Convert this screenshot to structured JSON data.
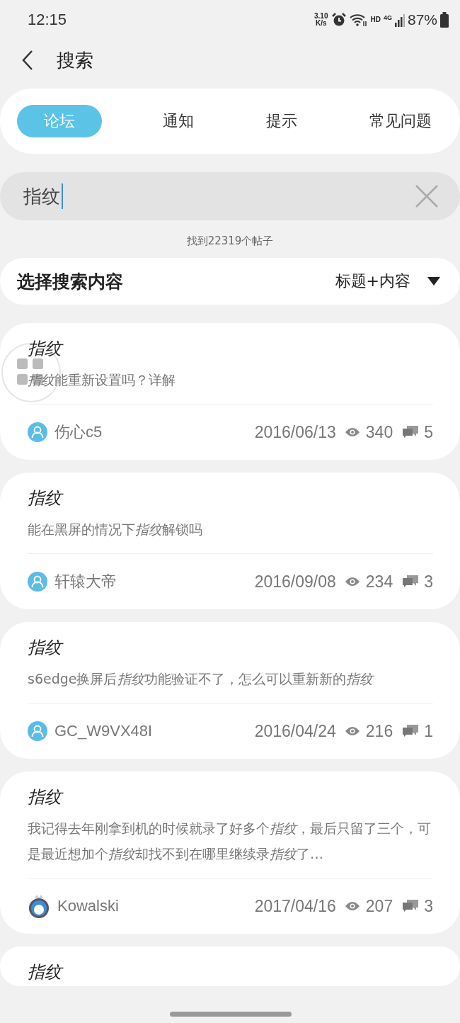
{
  "status_bar": {
    "time": "12:15",
    "speed": "3.10",
    "speed_unit": "K/s",
    "network": "HD",
    "generation": "4G",
    "battery": "87%"
  },
  "header": {
    "title": "搜索"
  },
  "tabs": [
    {
      "label": "论坛",
      "selected": true
    },
    {
      "label": "通知",
      "selected": false
    },
    {
      "label": "提示",
      "selected": false
    },
    {
      "label": "常见问题",
      "selected": false
    }
  ],
  "search": {
    "value": "指纹"
  },
  "result_count": "找到22319个帖子",
  "filter": {
    "label": "选择搜索内容",
    "value": "标题+内容"
  },
  "posts": [
    {
      "kind": "plain_avatar",
      "title": "指纹",
      "body": [
        {
          "text": "指纹",
          "italic": true
        },
        {
          "text": "能重新设置吗？详解",
          "italic": false
        }
      ],
      "author": "伤心c5",
      "date": "2016/06/13",
      "views": "340",
      "replies": "5"
    },
    {
      "kind": "plain_avatar",
      "title": "指纹",
      "body": [
        {
          "text": "能在黑屏的情况下",
          "italic": false
        },
        {
          "text": "指纹",
          "italic": true
        },
        {
          "text": "解锁吗",
          "italic": false
        }
      ],
      "author": "轩辕大帝",
      "date": "2016/09/08",
      "views": "234",
      "replies": "3"
    },
    {
      "kind": "plain_avatar",
      "title": "指纹",
      "body": [
        {
          "text": "s6edge换屏后",
          "italic": false
        },
        {
          "text": "指纹",
          "italic": true
        },
        {
          "text": "功能验证不了，怎么可以重新新的",
          "italic": false
        },
        {
          "text": "指纹",
          "italic": true
        }
      ],
      "author": "GC_W9VX48I",
      "date": "2016/04/24",
      "views": "216",
      "replies": "1"
    },
    {
      "kind": "photo_avatar",
      "title": "指纹",
      "body": [
        {
          "text": "我记得去年刚拿到机的时候就录了好多个",
          "italic": false
        },
        {
          "text": "指纹",
          "italic": true
        },
        {
          "text": "，最后只留了三个，可是最近想加个",
          "italic": false
        },
        {
          "text": "指纹",
          "italic": true
        },
        {
          "text": "却找不到在哪里继续录",
          "italic": false
        },
        {
          "text": "指纹",
          "italic": true
        },
        {
          "text": "了…",
          "italic": false
        }
      ],
      "author": "Kowalski",
      "date": "2017/04/16",
      "views": "207",
      "replies": "3"
    },
    {
      "title": "指纹"
    }
  ]
}
